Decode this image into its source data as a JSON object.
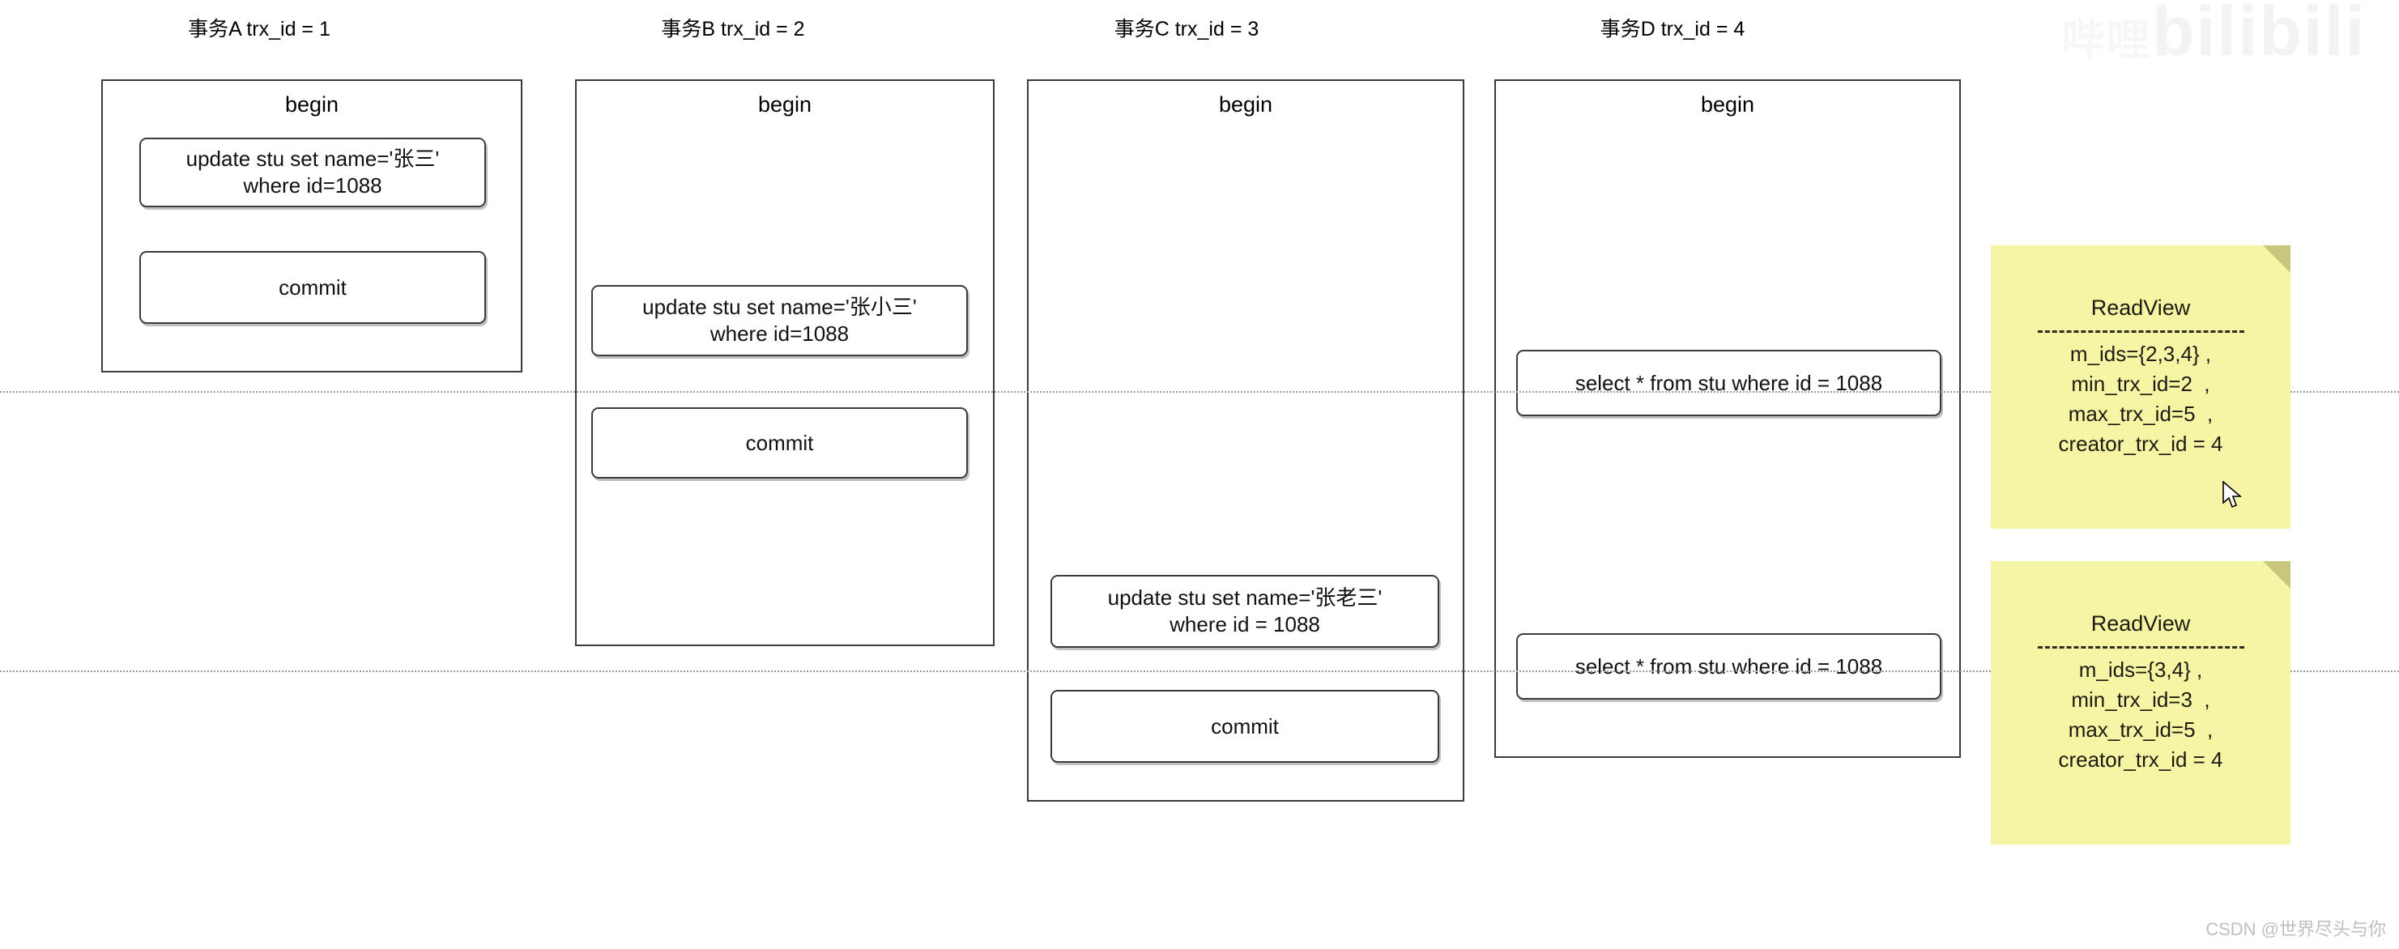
{
  "diagram": {
    "title_prefix": "事务",
    "transactions": [
      {
        "header": "事务A trx_id = 1",
        "begin_label": "begin",
        "statements": [
          {
            "text": "update stu set name='张三'\nwhere id=1088",
            "kind": "update"
          },
          {
            "text": "commit",
            "kind": "commit"
          }
        ]
      },
      {
        "header": "事务B trx_id = 2",
        "begin_label": "begin",
        "statements": [
          {
            "text": "update stu set name='张小三'\nwhere id=1088",
            "kind": "update"
          },
          {
            "text": "commit",
            "kind": "commit"
          }
        ]
      },
      {
        "header": "事务C trx_id = 3",
        "begin_label": "begin",
        "statements": [
          {
            "text": "update stu set name='张老三'\nwhere id = 1088",
            "kind": "update"
          },
          {
            "text": "commit",
            "kind": "commit"
          }
        ]
      },
      {
        "header": "事务D trx_id = 4",
        "begin_label": "begin",
        "statements": [
          {
            "text": "select * from stu where id = 1088",
            "kind": "select"
          },
          {
            "text": "select * from stu where id = 1088",
            "kind": "select"
          }
        ]
      }
    ],
    "readviews": [
      {
        "title": "ReadView",
        "lines": [
          "m_ids={2,3,4} ,",
          "min_trx_id=2  ,",
          "max_trx_id=5  ,",
          "creator_trx_id = 4"
        ]
      },
      {
        "title": "ReadView",
        "lines": [
          "m_ids={3,4} ,",
          "min_trx_id=3  ,",
          "max_trx_id=5  ,",
          "creator_trx_id = 4"
        ]
      }
    ],
    "colors": {
      "note_bg": "#f6f5a4",
      "note_fold": "#c9c77e",
      "box_border": "#3b3b3b",
      "timeline": "#9a9a9a",
      "watermark": "#bfbfbf"
    }
  },
  "watermarks": {
    "brand": "bilibili",
    "brand_small": "哔哩",
    "credit": "CSDN @世界尽头与你"
  }
}
